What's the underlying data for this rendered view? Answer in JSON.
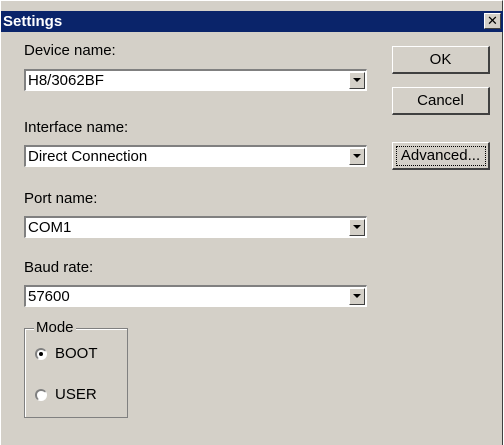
{
  "window": {
    "title": "Settings",
    "close_glyph": "✕"
  },
  "device": {
    "label": "Device name:",
    "value": "H8/3062BF"
  },
  "interface": {
    "label": "Interface name:",
    "value": "Direct Connection"
  },
  "port": {
    "label": "Port name:",
    "value": "COM1"
  },
  "baud": {
    "label": "Baud rate:",
    "value": "57600"
  },
  "buttons": {
    "ok": "OK",
    "cancel": "Cancel",
    "advanced": "Advanced..."
  },
  "mode": {
    "title": "Mode",
    "options": [
      {
        "label": "BOOT",
        "selected": true
      },
      {
        "label": "USER",
        "selected": false
      }
    ]
  }
}
